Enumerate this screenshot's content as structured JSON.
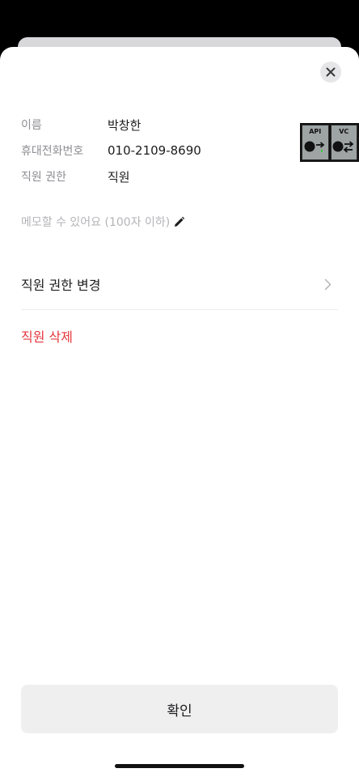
{
  "info": {
    "name_label": "이름",
    "name_value": "박창한",
    "phone_label": "휴대전화번호",
    "phone_value": "010-2109-8690",
    "role_label": "직원 권한",
    "role_value": "직원"
  },
  "memo": {
    "placeholder": "메모할 수 있어요 (100자 이하)"
  },
  "actions": {
    "change_role_label": "직원 권한 변경",
    "delete_label": "직원 삭제",
    "confirm_label": "확인"
  },
  "debug_overlay": {
    "api_label": "API",
    "vc_label": "VC"
  },
  "colors": {
    "danger": "#e5363b",
    "label_gray": "#8e8e93",
    "placeholder_gray": "#b4b4b8",
    "button_bg": "#efeff0"
  },
  "icons": {
    "close": "close-icon",
    "edit": "pencil-icon",
    "chevron": "chevron-right-icon"
  }
}
